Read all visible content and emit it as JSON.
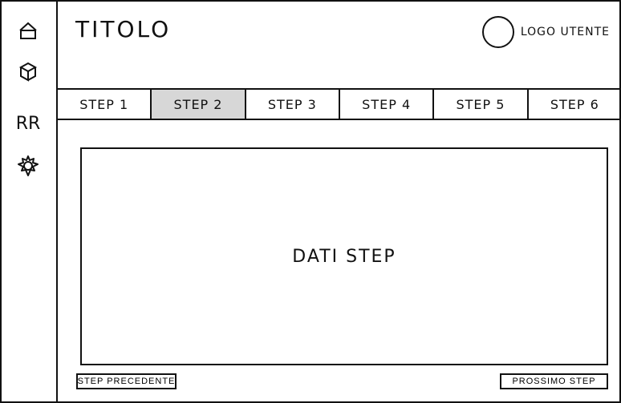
{
  "header": {
    "title": "TITOLO",
    "user_label": "LOGO UTENTE"
  },
  "sidebar": {
    "items": [
      {
        "icon": "home-icon"
      },
      {
        "icon": "box-icon"
      },
      {
        "icon": "users-icon"
      },
      {
        "icon": "gear-icon"
      }
    ],
    "users_label": "RR"
  },
  "tabs": [
    {
      "label": "STEP 1"
    },
    {
      "label": "STEP 2",
      "active": true
    },
    {
      "label": "STEP 3"
    },
    {
      "label": "STEP 4"
    },
    {
      "label": "STEP 5"
    },
    {
      "label": "STEP 6"
    }
  ],
  "main": {
    "content_label": "DATI STEP"
  },
  "footer": {
    "prev_label": "STEP PRECEDENTE",
    "next_label": "PROSSIMO STEP"
  },
  "colors": {
    "active_tab": "#d7d7d7",
    "line": "#111111",
    "background": "#ffffff"
  }
}
